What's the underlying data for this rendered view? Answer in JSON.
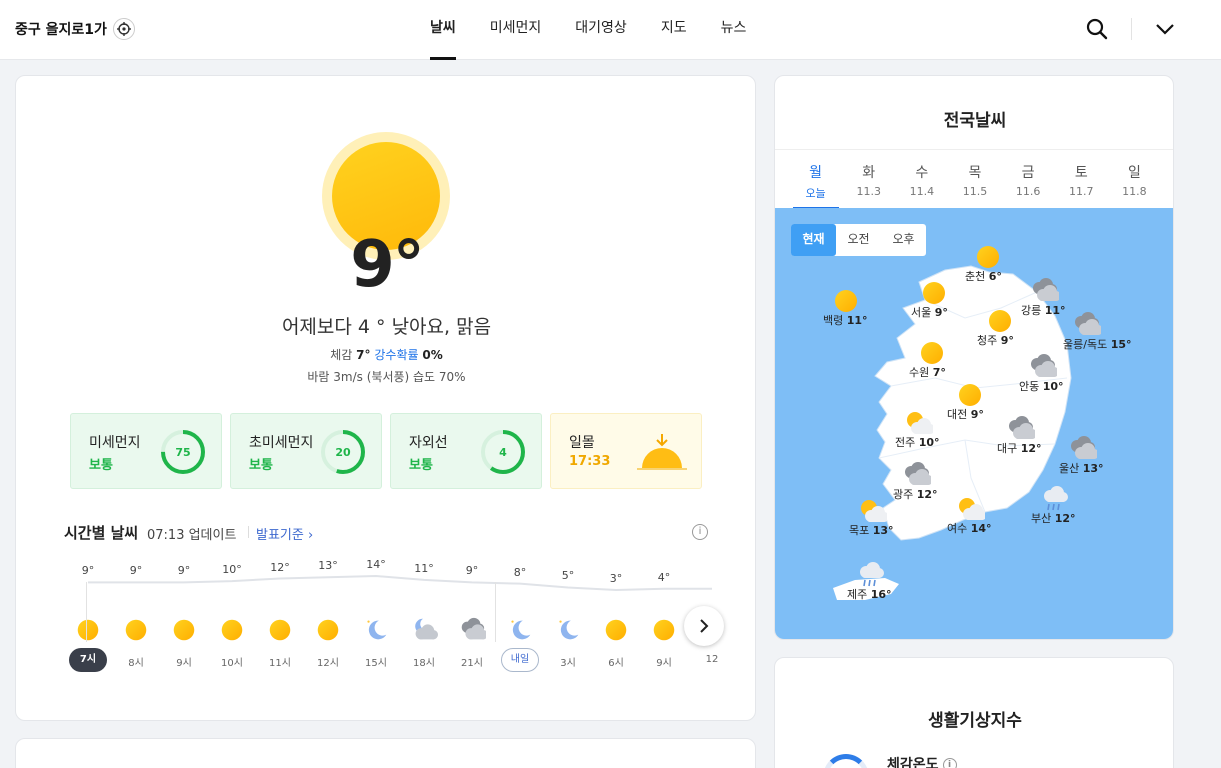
{
  "header": {
    "location": "중구 을지로1가",
    "nav": [
      "날씨",
      "미세먼지",
      "대기영상",
      "지도",
      "뉴스"
    ],
    "active_nav": "날씨"
  },
  "current": {
    "temp": "9°",
    "summary": "어제보다 4 ° 낮아요, 맑음",
    "feels_label": "체감",
    "feels_value": "7°",
    "precip_label": "강수확률",
    "precip_value": "0%",
    "wind_humidity": "바람 3m/s (북서풍) 습도 70%"
  },
  "tiles": [
    {
      "name": "미세먼지",
      "status": "보통",
      "value": "75",
      "level": 0.75
    },
    {
      "name": "초미세먼지",
      "status": "보통",
      "value": "20",
      "level": 0.55
    },
    {
      "name": "자외선",
      "status": "보통",
      "value": "4",
      "level": 0.6
    },
    {
      "name": "일몰",
      "status": "17:33"
    }
  ],
  "hourly": {
    "title": "시간별 날씨",
    "update": "07:13 업데이트",
    "basis_link": "발표기준",
    "info": "i",
    "items": [
      {
        "temp": "9°",
        "time": "7시",
        "icon": "sun-icon"
      },
      {
        "temp": "9°",
        "time": "8시",
        "icon": "sun-icon"
      },
      {
        "temp": "9°",
        "time": "9시",
        "icon": "sun-icon"
      },
      {
        "temp": "10°",
        "time": "10시",
        "icon": "sun-icon"
      },
      {
        "temp": "12°",
        "time": "11시",
        "icon": "sun-icon"
      },
      {
        "temp": "13°",
        "time": "12시",
        "icon": "sun-icon"
      },
      {
        "temp": "14°",
        "time": "15시",
        "icon": "moon-icon"
      },
      {
        "temp": "11°",
        "time": "18시",
        "icon": "moon-cloud-icon"
      },
      {
        "temp": "9°",
        "time": "21시",
        "icon": "cloud-icon"
      },
      {
        "temp": "8°",
        "time": "내일",
        "icon": "moon-icon"
      },
      {
        "temp": "5°",
        "time": "3시",
        "icon": "moon-icon"
      },
      {
        "temp": "3°",
        "time": "6시",
        "icon": "sun-icon"
      },
      {
        "temp": "4°",
        "time": "9시",
        "icon": "sun-icon"
      },
      {
        "temp": "",
        "time": "12",
        "icon": "sun-icon"
      }
    ]
  },
  "national": {
    "title": "전국날씨",
    "days": [
      {
        "day": "월",
        "date": "오늘"
      },
      {
        "day": "화",
        "date": "11.3"
      },
      {
        "day": "수",
        "date": "11.4"
      },
      {
        "day": "목",
        "date": "11.5"
      },
      {
        "day": "금",
        "date": "11.6"
      },
      {
        "day": "토",
        "date": "11.7"
      },
      {
        "day": "일",
        "date": "11.8"
      }
    ],
    "periods": [
      "현재",
      "오전",
      "오후"
    ],
    "cities": [
      {
        "name": "춘천",
        "temp": "6°",
        "icon": "sun-icon"
      },
      {
        "name": "백령",
        "temp": "11°",
        "icon": "sun-icon"
      },
      {
        "name": "서울",
        "temp": "9°",
        "icon": "sun-icon"
      },
      {
        "name": "강릉",
        "temp": "11°",
        "icon": "cloud-icon"
      },
      {
        "name": "울릉/독도",
        "temp": "15°",
        "icon": "cloud-icon"
      },
      {
        "name": "청주",
        "temp": "9°",
        "icon": "sun-icon"
      },
      {
        "name": "수원",
        "temp": "7°",
        "icon": "sun-icon"
      },
      {
        "name": "안동",
        "temp": "10°",
        "icon": "cloud-icon"
      },
      {
        "name": "대전",
        "temp": "9°",
        "icon": "sun-icon"
      },
      {
        "name": "전주",
        "temp": "10°",
        "icon": "sun-cloud-icon"
      },
      {
        "name": "대구",
        "temp": "12°",
        "icon": "cloud-icon"
      },
      {
        "name": "울산",
        "temp": "13°",
        "icon": "cloud-icon"
      },
      {
        "name": "광주",
        "temp": "12°",
        "icon": "cloud-icon"
      },
      {
        "name": "목포",
        "temp": "13°",
        "icon": "sun-cloud-icon"
      },
      {
        "name": "여수",
        "temp": "14°",
        "icon": "sun-cloud-icon"
      },
      {
        "name": "부산",
        "temp": "12°",
        "icon": "rain-icon"
      },
      {
        "name": "제주",
        "temp": "16°",
        "icon": "rain-icon"
      }
    ]
  },
  "life": {
    "title": "생활기상지수",
    "item": "체감온도",
    "info": "i"
  },
  "colors": {
    "accent": "#1e73e8",
    "good": "#1fb54a",
    "sun": "#ffb90a",
    "map_water": "#7ebef6"
  }
}
